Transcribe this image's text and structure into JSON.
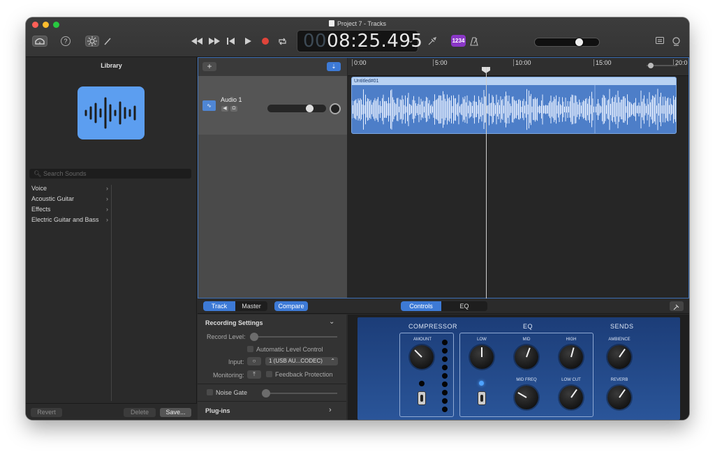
{
  "window": {
    "title": "Project 7 - Tracks"
  },
  "toolbar": {
    "lcd_dim_digits": "00",
    "lcd_time": "08:25.495",
    "count_in_label": "1234"
  },
  "library": {
    "title": "Library",
    "search_placeholder": "Search Sounds",
    "categories": [
      {
        "label": "Voice"
      },
      {
        "label": "Acoustic Guitar"
      },
      {
        "label": "Effects"
      },
      {
        "label": "Electric Guitar and Bass"
      }
    ],
    "revert_label": "Revert",
    "delete_label": "Delete",
    "save_label": "Save..."
  },
  "tracks": {
    "track_name": "Audio 1",
    "region_name": "Untitled#01",
    "ruler": [
      "0:00",
      "5:00",
      "10:00",
      "15:00",
      "20:0"
    ]
  },
  "editor": {
    "track_tab": "Track",
    "master_tab": "Master",
    "compare_label": "Compare",
    "controls_tab": "Controls",
    "eq_tab": "EQ",
    "recording_settings": "Recording Settings",
    "record_level": "Record Level:",
    "auto_level": "Automatic Level Control",
    "input_label": "Input:",
    "input_value": "1 (USB AU...CODEC)",
    "monitoring_label": "Monitoring:",
    "feedback_protection": "Feedback Protection",
    "noise_gate": "Noise Gate",
    "plugins": "Plug-ins"
  },
  "plugin": {
    "compressor_title": "COMPRESSOR",
    "eq_title": "EQ",
    "sends_title": "SENDS",
    "amount": "AMOUNT",
    "low": "LOW",
    "mid": "MID",
    "high": "HIGH",
    "mid_freq": "MID FREQ",
    "low_cut": "LOW CUT",
    "ambience": "AMBIENCE",
    "reverb": "REVERB"
  },
  "colors": {
    "accent": "#3d7ad6",
    "region": "#4d7ec8",
    "record": "#e0443a",
    "plugin_panel": "#24488a"
  }
}
